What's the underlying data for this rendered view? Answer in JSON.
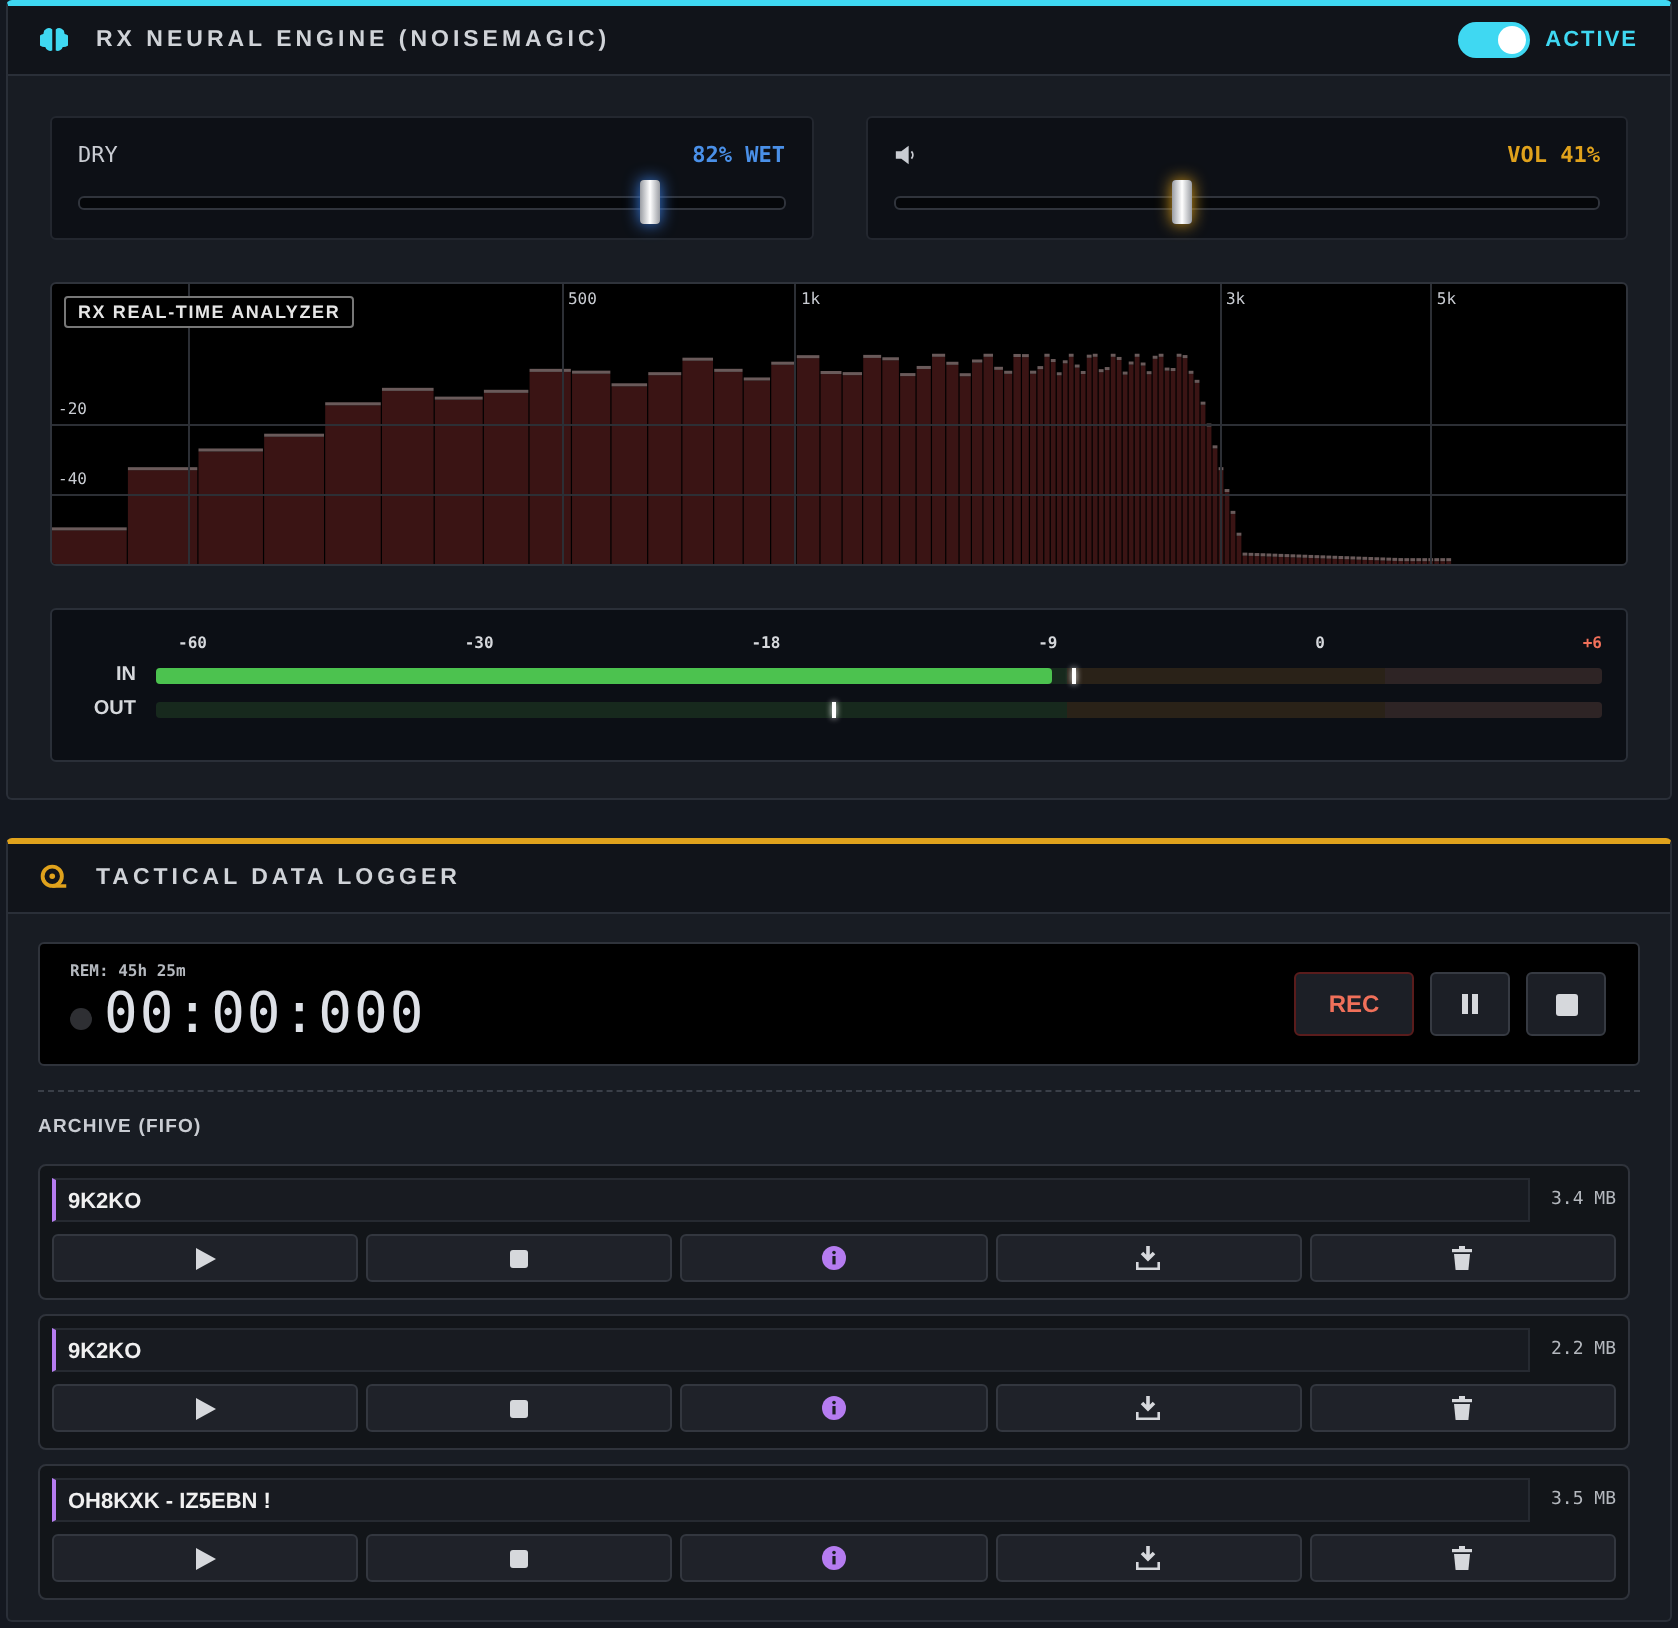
{
  "engine": {
    "title": "RX NEURAL ENGINE (NOISEMAGIC)",
    "toggle": {
      "on": true,
      "label": "ACTIVE"
    },
    "mix": {
      "label": "DRY",
      "reading": "82% WET",
      "level": 0.81
    },
    "volume": {
      "reading": "VOL 41%",
      "level": 0.41
    },
    "analyzer": {
      "title": "RX REAL-TIME ANALYZER",
      "freq_labels": [
        "500",
        "1k",
        "3k",
        "5k"
      ],
      "db_labels": [
        "-20",
        "-40"
      ]
    },
    "meters": {
      "scale": [
        {
          "label": "-60",
          "kind": "normal"
        },
        {
          "label": "-30",
          "kind": "normal"
        },
        {
          "label": "-18",
          "kind": "normal"
        },
        {
          "label": "-9",
          "kind": "normal"
        },
        {
          "label": "0",
          "kind": "normal"
        },
        {
          "label": "+6",
          "kind": "over"
        }
      ],
      "channels": [
        {
          "name": "IN",
          "level": 0.62,
          "peak": {
            "level": 0.634
          }
        },
        {
          "name": "OUT",
          "peak": {
            "level": 0.467
          }
        }
      ]
    }
  },
  "logger": {
    "title": "TACTICAL DATA LOGGER",
    "remaining": "REM: 45h 25m",
    "timer": "00:00:000",
    "recording": false,
    "rec_button": "REC",
    "archive_label": "ARCHIVE (FIFO)",
    "items": [
      {
        "name": "9K2KO",
        "size": "3.4 MB"
      },
      {
        "name": "9K2KO",
        "size": "2.2 MB"
      },
      {
        "name": "OH8KXK - IZ5EBN !",
        "size": "3.5 MB"
      }
    ]
  }
}
